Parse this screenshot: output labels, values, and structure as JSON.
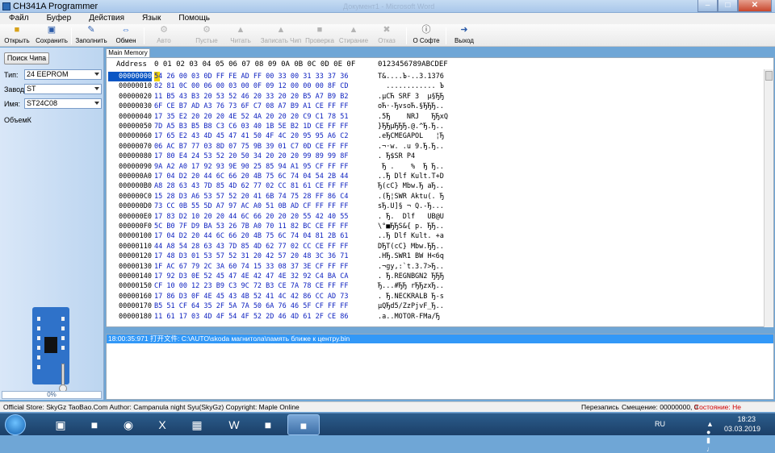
{
  "window": {
    "title": "CH341A Programmer",
    "background_title": "Документ1 - Microsoft Word"
  },
  "menu": [
    "Файл",
    "Буфер",
    "Действия",
    "Язык",
    "Помощь"
  ],
  "toolbar": [
    {
      "label": "Открыть",
      "icon": "folder-open-icon",
      "enabled": true
    },
    {
      "label": "Сохранить",
      "icon": "save-icon",
      "enabled": true
    },
    {
      "label": "Заполнить",
      "icon": "fill-icon",
      "enabled": true
    },
    {
      "label": "Обмен",
      "icon": "swap-icon",
      "enabled": true
    },
    {
      "label": "Авто",
      "icon": "auto-icon",
      "enabled": false
    },
    {
      "label": "Пустые",
      "icon": "blank-check-icon",
      "enabled": false
    },
    {
      "label": "Читать",
      "icon": "read-icon",
      "enabled": false
    },
    {
      "label": "Записать Чип",
      "icon": "write-icon",
      "enabled": false
    },
    {
      "label": "Проверка",
      "icon": "verify-icon",
      "enabled": false
    },
    {
      "label": "Стирание",
      "icon": "erase-icon",
      "enabled": false
    },
    {
      "label": "Отказ",
      "icon": "cancel-icon",
      "enabled": false
    },
    {
      "label": "О Софте",
      "icon": "info-icon",
      "enabled": true
    },
    {
      "label": "Выход",
      "icon": "exit-icon",
      "enabled": true
    }
  ],
  "left": {
    "search_button": "Поиск Чипа",
    "type_label": "Тип:",
    "type_value": "24 EEPROM",
    "maker_label": "Завод:",
    "maker_value": "ST",
    "name_label": "Имя:",
    "name_value": "ST24C08",
    "volume_label": "ОбъемК",
    "progress_text": "0%",
    "progress_fraction": 0
  },
  "tab": "Main Memory",
  "hex": {
    "header_addr": "Address",
    "header_cols": [
      "0",
      "01",
      "02",
      "03",
      "04",
      "05",
      "06",
      "07",
      "08",
      "09",
      "0A",
      "0B",
      "0C",
      "0D",
      "0E",
      "0F"
    ],
    "header_ascii": "0123456789ABCDEF",
    "rows": [
      {
        "addr": "00000000",
        "hex": "54 26 00 03 0D FF FE AD FF 00 33 00 31 33 37 36",
        "ascii": "T&....Ъ-..3.1376"
      },
      {
        "addr": "00000010",
        "hex": "82 81 0C 00 06 00 03 00 0F 09 12 00 00 00 8F CD",
        "ascii": "  ............ Ъ"
      },
      {
        "addr": "00000020",
        "hex": "11 B5 43 B3 20 53 52 46 20 33 20 20 B5 A7 B9 B2",
        "ascii": ".µCЋ SRF 3  µ§ЂЂ"
      },
      {
        "addr": "00000030",
        "hex": "6F CE B7 AD A3 76 73 6F C7 08 A7 B9 A1 CE FF FF",
        "ascii": "oЋ·-ЂvsoЋ.§ЂЂЂ.."
      },
      {
        "addr": "00000040",
        "hex": "17 35 E2 20 20 20 4E 52 4A 20 20 20 C9 C1 78 51",
        "ascii": ".5Ђ    NRJ   ЂЂxQ"
      },
      {
        "addr": "00000050",
        "hex": "7D A5 B3 B5 B8 C3 C6 03 40 1B 5E B2 1D CE FF FF",
        "ascii": "}ЂЂµЂЂЂ.@.^Ђ.Ђ.."
      },
      {
        "addr": "00000060",
        "hex": "17 65 E2 43 4D 45 47 41 50 4F 4C 20 95 95 A6 C2",
        "ascii": ".eЂCMEGAPOL   ¦Ђ"
      },
      {
        "addr": "00000070",
        "hex": "06 AC B7 77 03 8D 07 75 9B 39 01 C7 0D CE FF FF",
        "ascii": ".¬·w. .u 9.Ђ.Ђ.."
      },
      {
        "addr": "00000080",
        "hex": "17 80 E4 24 53 52 20 50 34 20 20 20 99 89 99 8F",
        "ascii": ". Ђ$SR P4       "
      },
      {
        "addr": "00000090",
        "hex": "9A A2 A0 17 92 93 9E 90 25 85 94 A1 95 CF FF FF",
        "ascii": " Ђ .    %  Ђ Ђ.."
      },
      {
        "addr": "000000A0",
        "hex": "17 04 D2 20 44 6C 66 20 4B 75 6C 74 04 54 2B 44",
        "ascii": "..Ђ Dlf Kult.T+D"
      },
      {
        "addr": "000000B0",
        "hex": "A8 28 63 43 7D 85 4D 62 77 02 CC 81 61 CE FF FF",
        "ascii": "Ђ(cC} Mbw.Ђ aЂ.."
      },
      {
        "addr": "000000C0",
        "hex": "15 28 D3 A6 53 57 52 20 41 6B 74 75 28 FF 86 C4",
        "ascii": ".(Ђ¦SWR Aktu(. Ђ"
      },
      {
        "addr": "000000D0",
        "hex": "73 CC 0B 55 5D A7 97 AC A0 51 0B AD CF FF FF FF",
        "ascii": "sЂ.U]§ ¬ Q.-Ђ..."
      },
      {
        "addr": "000000E0",
        "hex": "17 83 D2 10 20 20 44 6C 66 20 20 20 55 42 40 55",
        "ascii": ". Ђ.  Dlf   UB@U"
      },
      {
        "addr": "000000F0",
        "hex": "5C B0 7F D9 BA 53 26 7B A0 70 11 82 BC CE FF FF",
        "ascii": "\\°■ЂЂS&{ p. ЂЂ.."
      },
      {
        "addr": "00000100",
        "hex": "17 04 D2 20 44 6C 66 20 4B 75 6C 74 04 81 2B 61",
        "ascii": "..Ђ Dlf Kult. +a"
      },
      {
        "addr": "00000110",
        "hex": "44 A8 54 28 63 43 7D 85 4D 62 77 02 CC CE FF FF",
        "ascii": "DЂT(cC} Mbw.ЂЂ.."
      },
      {
        "addr": "00000120",
        "hex": "17 48 D3 01 53 57 52 31 20 42 57 20 48 3C 36 71",
        "ascii": ".HЂ.SWR1 BW H<6q"
      },
      {
        "addr": "00000130",
        "hex": "1F AC 67 79 2C 3A 60 74 15 33 08 37 3E CF FF FF",
        "ascii": ".¬gy,:`t.3.7>Ђ.."
      },
      {
        "addr": "00000140",
        "hex": "17 92 D3 0E 52 45 47 4E 42 47 4E 32 92 C4 BA CA",
        "ascii": ". Ђ.REGNBGN2 ЂЂЂ"
      },
      {
        "addr": "00000150",
        "hex": "CF 10 00 12 23 B9 C3 9C 72 B3 CE 7A 78 CE FF FF",
        "ascii": "Ђ...#ЂЂ rЂЂzxЂ.."
      },
      {
        "addr": "00000160",
        "hex": "17 86 D3 0F 4E 45 43 4B 52 41 4C 42 86 CC AD 73",
        "ascii": ". Ђ.NECKRALB Ђ-s"
      },
      {
        "addr": "00000170",
        "hex": "B5 51 CF 64 35 2F 5A 7A 50 6A 76 46 5F CF FF FF",
        "ascii": "µQЂd5/ZzPjvF_Ђ.."
      },
      {
        "addr": "00000180",
        "hex": "11 61 17 03 4D 4F 54 4F 52 2D 46 4D 61 2F CE 86",
        "ascii": ".a..MOTOR-FMa/Ђ "
      }
    ]
  },
  "log": {
    "line": "18:00:35:971 打开文件: C:\\AUTO\\skoda магнитола\\память ближе к центру.bin"
  },
  "status": {
    "left": "Official Store: SkyGz TaoBao.Com Author: Campanula night Syu(SkyGz) Copyright: Maple Online",
    "mode": "Перезапись",
    "offset": "Смещение: 00000000, 0",
    "state": "Состояние: Не подключен",
    "state_color": "#d00000"
  },
  "taskbar": {
    "apps": [
      "start-orb-icon",
      "explorer-icon",
      "file-manager-icon",
      "chrome-icon",
      "excel-icon",
      "calculator-icon",
      "word-icon",
      "image-viewer-icon",
      "ch341a-icon"
    ],
    "lang": "RU",
    "time": "18:23",
    "date": "03.03.2019"
  }
}
